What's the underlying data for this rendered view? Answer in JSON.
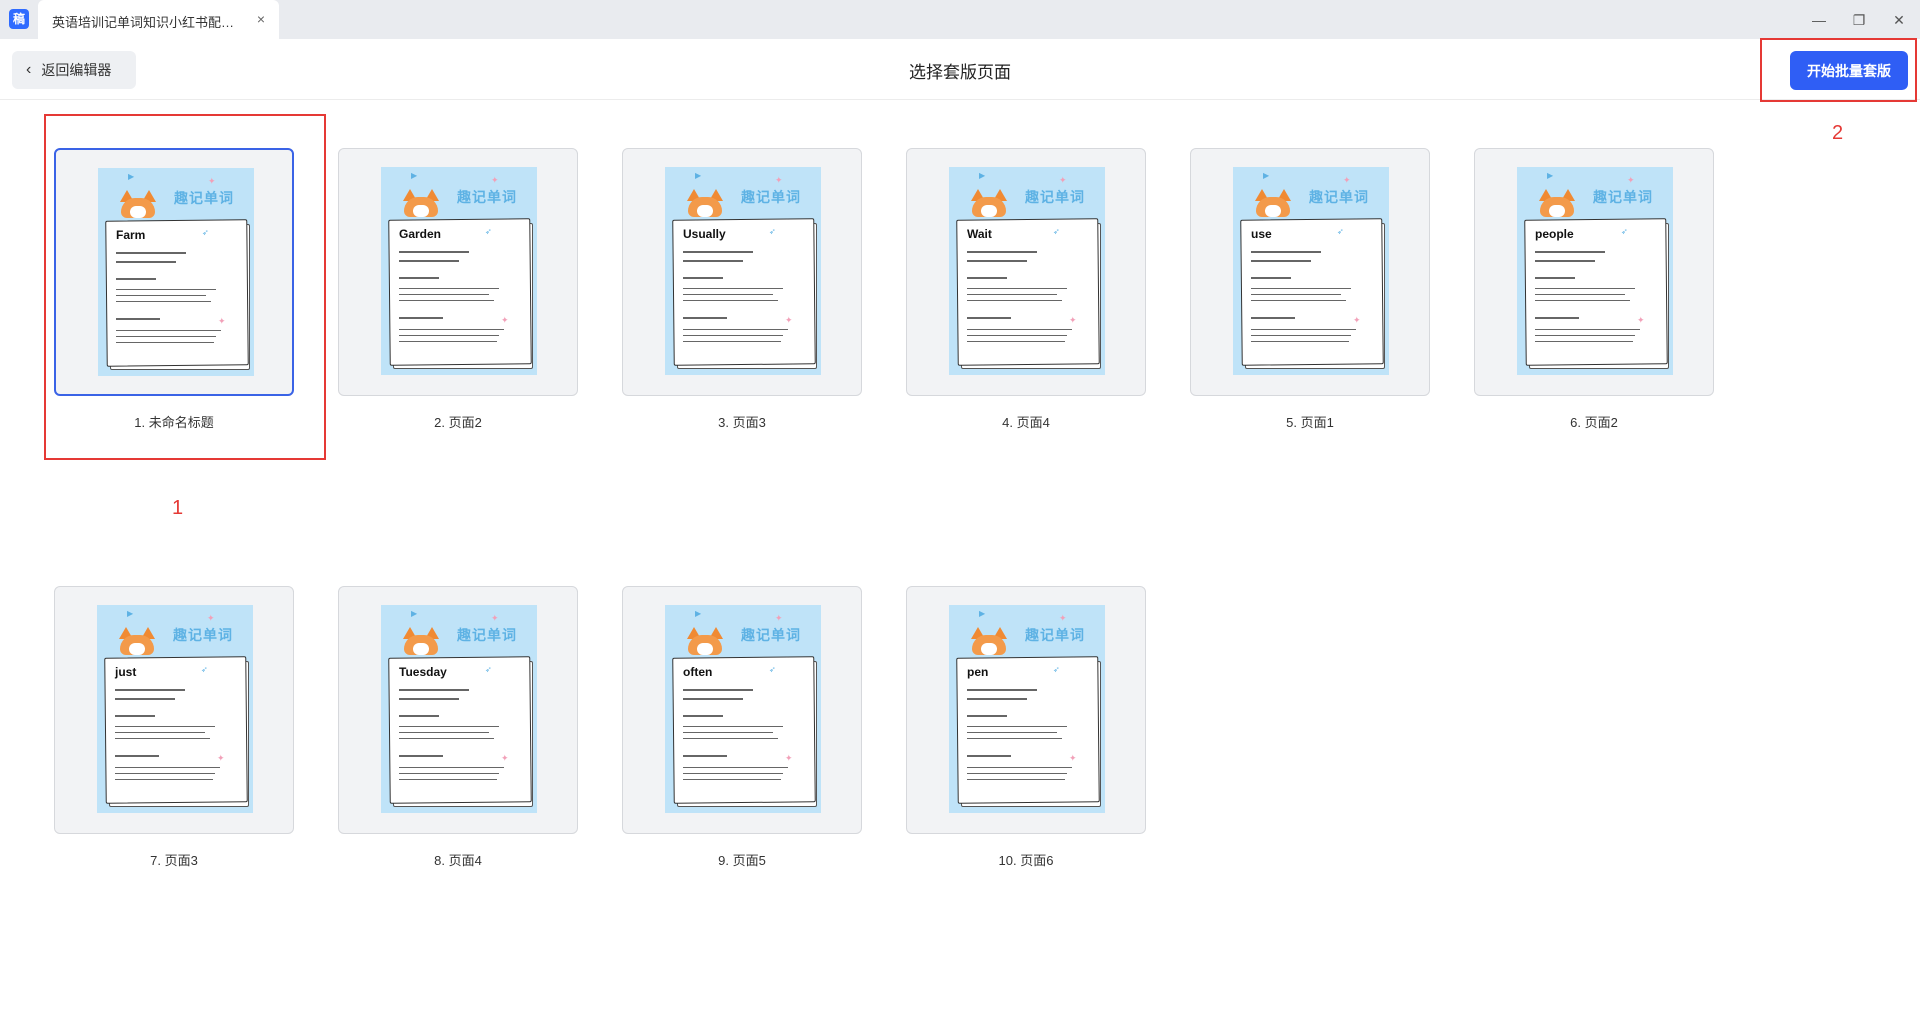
{
  "app": {
    "icon_label": "稿",
    "tab_title": "英语培训记单词知识小红书配图_...",
    "tab_close": "×"
  },
  "window": {
    "minimize": "—",
    "restore": "❐",
    "close": "✕"
  },
  "header": {
    "back_label": "返回编辑器",
    "title": "选择套版页面",
    "primary_label": "开始批量套版"
  },
  "annotations": {
    "num1": "1",
    "num2": "2",
    "color": "#e53935"
  },
  "thumb_heading": "趣记单词",
  "pages": [
    {
      "label": "1. 未命名标题",
      "word": "Farm",
      "selected": true
    },
    {
      "label": "2. 页面2",
      "word": "Garden",
      "selected": false
    },
    {
      "label": "3. 页面3",
      "word": "Usually",
      "selected": false
    },
    {
      "label": "4. 页面4",
      "word": "Wait",
      "selected": false
    },
    {
      "label": "5. 页面1",
      "word": "use",
      "selected": false
    },
    {
      "label": "6. 页面2",
      "word": "people",
      "selected": false
    },
    {
      "label": "7. 页面3",
      "word": "just",
      "selected": false
    },
    {
      "label": "8. 页面4",
      "word": "Tuesday",
      "selected": false
    },
    {
      "label": "9. 页面5",
      "word": "often",
      "selected": false
    },
    {
      "label": "10. 页面6",
      "word": "pen",
      "selected": false
    }
  ],
  "colors": {
    "primary": "#2f5ef5",
    "selected_border": "#3a63e6",
    "thumb_bg": "#bfe3f8"
  }
}
